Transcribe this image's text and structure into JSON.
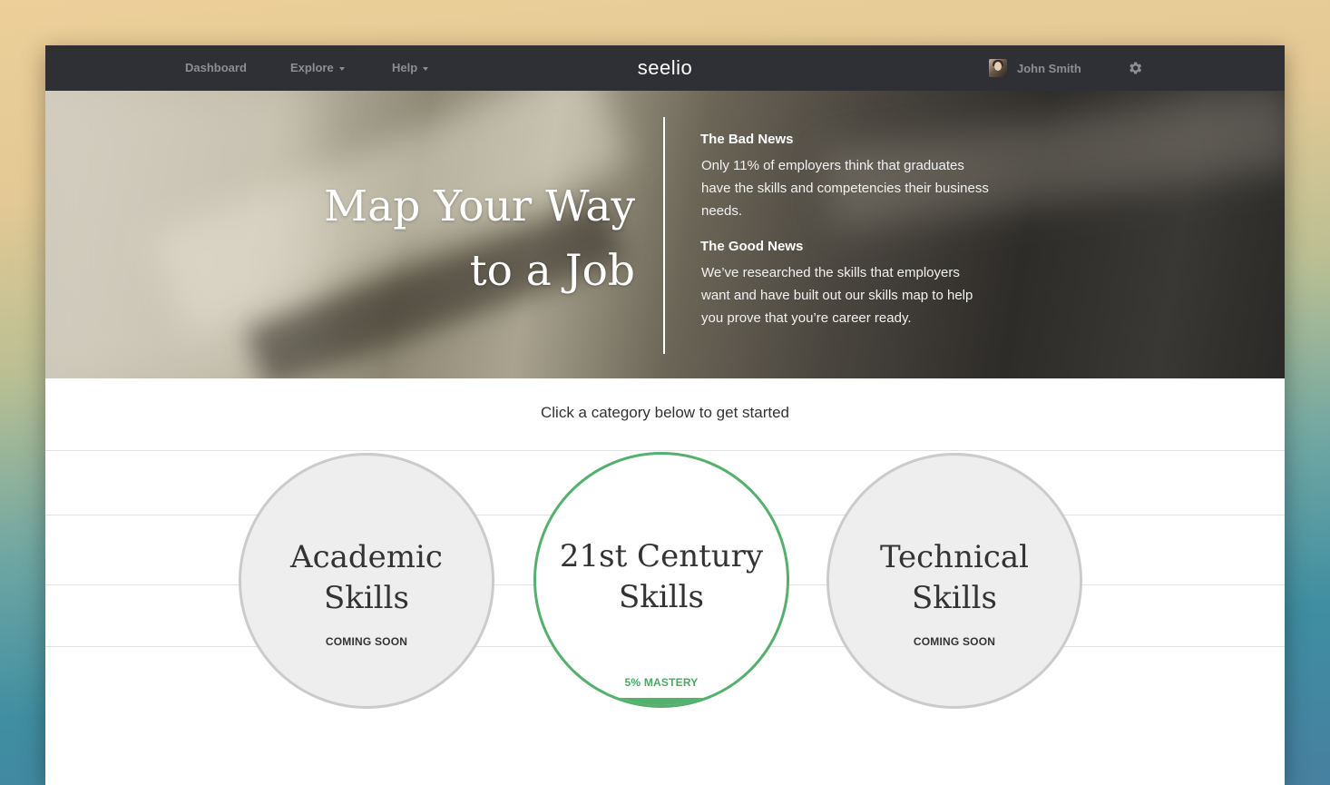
{
  "nav": {
    "dashboard": "Dashboard",
    "explore": "Explore",
    "help": "Help",
    "logo": "seelio",
    "user_name": "John Smith",
    "avatar_icon": "user-avatar",
    "settings_icon": "gear-icon"
  },
  "hero": {
    "title_line1": "Map Your Way",
    "title_line2": "to a Job",
    "bad_news": {
      "heading": "The Bad News",
      "text": "Only 11% of employers think that graduates have the skills and competencies their business needs."
    },
    "good_news": {
      "heading": "The Good News",
      "text": "We’ve researched the skills that employers want and have built out our skills map to help you prove that you’re career ready."
    }
  },
  "prompt": "Click a category below to get started",
  "categories": [
    {
      "line1": "Academic",
      "line2": "Skills",
      "status": "COMING SOON"
    },
    {
      "line1": "21st Century",
      "line2": "Skills",
      "status": "5% MASTERY",
      "mastery": 0.05
    },
    {
      "line1": "Technical",
      "line2": "Skills",
      "status": "COMING SOON"
    }
  ],
  "colors": {
    "navbar": "#2f3036",
    "accent_green": "#55b06d",
    "circle_grey": "#eeeeee",
    "circle_border": "#cbcbcb"
  }
}
